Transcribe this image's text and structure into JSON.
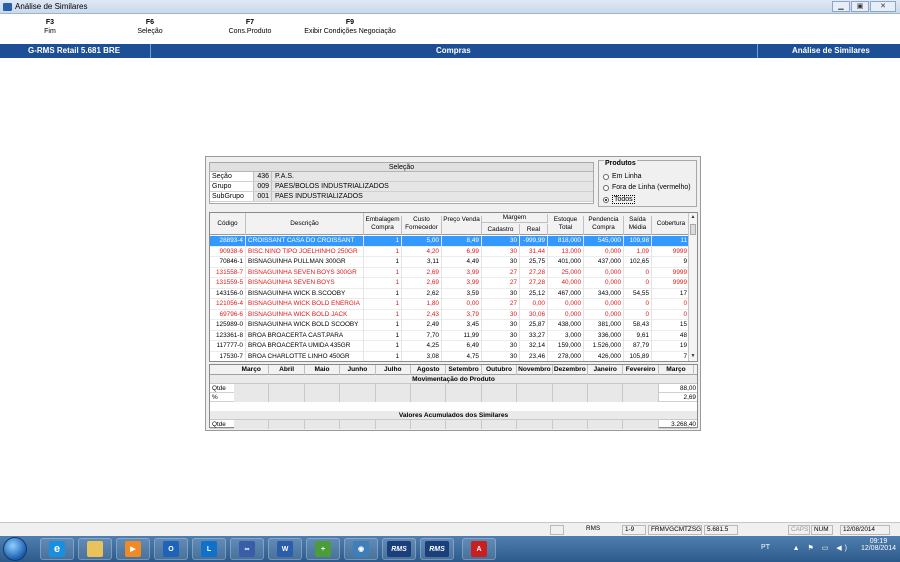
{
  "window": {
    "title": "Análise de Similares"
  },
  "fkeys": [
    {
      "key": "F3",
      "label": "Fim"
    },
    {
      "key": "F6",
      "label": "Seleção"
    },
    {
      "key": "F7",
      "label": "Cons.Produto"
    },
    {
      "key": "F9",
      "label": "Exibir Condições Negociação"
    }
  ],
  "banner": {
    "left": "G-RMS Retail 5.681 BRE",
    "center": "Compras",
    "right": "Análise de Similares"
  },
  "selecao": {
    "title": "Seleção",
    "rows": [
      {
        "label": "Seção",
        "code": "436",
        "desc": "P.A.S."
      },
      {
        "label": "Grupo",
        "code": "009",
        "desc": "PAES/BOLOS INDUSTRIALIZADOS"
      },
      {
        "label": "SubGrupo",
        "code": "001",
        "desc": "PAES INDUSTRIALIZADOS"
      }
    ]
  },
  "produtos": {
    "legend": "Produtos",
    "options": [
      "Em Linha",
      "Fora de Linha (vermelho)",
      "Todos"
    ],
    "selected": 2
  },
  "grid": {
    "headers": {
      "codigo": "Código",
      "descricao": "Descrição",
      "embalagem": "Embalagem Compra",
      "custo": "Custo Fornecedor",
      "preco": "Preço Venda",
      "margem": "Margem",
      "margem_cad": "Cadastro",
      "margem_real": "Real",
      "estoque": "Estoque Total",
      "pendencia": "Pendencia Compra",
      "saida": "Saída Média",
      "cobertura": "Cobertura"
    },
    "rows": [
      {
        "codigo": "28893-4",
        "desc": "CROISSANT CASA DO CROISSANT",
        "emb": "1",
        "custo": "5,00",
        "preco": "8,49",
        "cad": "30",
        "real": "-999,99",
        "estoque": "818,000",
        "pend": "545,000",
        "saida": "109,98",
        "cob": "11",
        "red": true,
        "selected": true
      },
      {
        "codigo": "90938-6",
        "desc": "BISC.NINO TIPO JOELHINHO 250GR",
        "emb": "1",
        "custo": "4,20",
        "preco": "6,99",
        "cad": "30",
        "real": "31,44",
        "estoque": "13,000",
        "pend": "0,000",
        "saida": "1,09",
        "cob": "9999",
        "red": true
      },
      {
        "codigo": "70846-1",
        "desc": "BISNAGUINHA PULLMAN 300GR",
        "emb": "1",
        "custo": "3,11",
        "preco": "4,49",
        "cad": "30",
        "real": "25,75",
        "estoque": "401,000",
        "pend": "437,000",
        "saida": "102,65",
        "cob": "9",
        "red": false
      },
      {
        "codigo": "131558-7",
        "desc": "BISNAGUINHA SEVEN BOYS 300GR",
        "emb": "1",
        "custo": "2,69",
        "preco": "3,99",
        "cad": "27",
        "real": "27,28",
        "estoque": "25,000",
        "pend": "0,000",
        "saida": "0",
        "cob": "9999",
        "red": true
      },
      {
        "codigo": "131559-5",
        "desc": "BISNAGUINHA SEVEN BOYS",
        "emb": "1",
        "custo": "2,69",
        "preco": "3,99",
        "cad": "27",
        "real": "27,28",
        "estoque": "40,000",
        "pend": "0,000",
        "saida": "0",
        "cob": "9999",
        "red": true
      },
      {
        "codigo": "143156-0",
        "desc": "BISNAGUINHA WICK B.SCOOBY",
        "emb": "1",
        "custo": "2,62",
        "preco": "3,59",
        "cad": "30",
        "real": "25,12",
        "estoque": "467,000",
        "pend": "343,000",
        "saida": "54,55",
        "cob": "17",
        "red": false
      },
      {
        "codigo": "121056-4",
        "desc": "BISNAGUINHA WICK BOLD ENERGIA",
        "emb": "1",
        "custo": "1,80",
        "preco": "0,00",
        "cad": "27",
        "real": "0,00",
        "estoque": "0,000",
        "pend": "0,000",
        "saida": "0",
        "cob": "0",
        "red": true
      },
      {
        "codigo": "69796-6",
        "desc": "BISNAGUINHA WICK BOLD JACK",
        "emb": "1",
        "custo": "2,43",
        "preco": "3,79",
        "cad": "30",
        "real": "30,06",
        "estoque": "0,000",
        "pend": "0,000",
        "saida": "0",
        "cob": "0",
        "red": true
      },
      {
        "codigo": "125989-0",
        "desc": "BISNAGUINHA WICK BOLD SCOOBY",
        "emb": "1",
        "custo": "2,49",
        "preco": "3,45",
        "cad": "30",
        "real": "25,87",
        "estoque": "438,000",
        "pend": "381,000",
        "saida": "58,43",
        "cob": "15",
        "red": false
      },
      {
        "codigo": "123361-8",
        "desc": "BROA BROACERTA CAST.PARA",
        "emb": "1",
        "custo": "7,70",
        "preco": "11,99",
        "cad": "30",
        "real": "33,27",
        "estoque": "3,000",
        "pend": "336,000",
        "saida": "9,61",
        "cob": "48",
        "red": false
      },
      {
        "codigo": "117777-0",
        "desc": "BROA BROACERTA UMIDA 435GR",
        "emb": "1",
        "custo": "4,25",
        "preco": "6,49",
        "cad": "30",
        "real": "32,14",
        "estoque": "159,000",
        "pend": "1.526,000",
        "saida": "87,79",
        "cob": "19",
        "red": false
      },
      {
        "codigo": "17530-7",
        "desc": "BROA CHARLOTTE LINHO 450GR",
        "emb": "1",
        "custo": "3,08",
        "preco": "4,75",
        "cad": "30",
        "real": "23,46",
        "estoque": "278,000",
        "pend": "426,000",
        "saida": "105,89",
        "cob": "7",
        "red": false
      }
    ]
  },
  "months": {
    "headers": [
      "Março",
      "Abril",
      "Maio",
      "Junho",
      "Julho",
      "Agosto",
      "Setembro",
      "Outubro",
      "Novembro",
      "Dezembro",
      "Janeiro",
      "Fevereiro",
      "Março"
    ],
    "section1": "Movimentação do Produto",
    "section2": "Valores Acumulados dos Similares",
    "rows": {
      "qtde_label": "Qtde",
      "qtde_total": "88,00",
      "pct_label": "%",
      "pct_total": "2,69",
      "acc_label": "Qtde",
      "acc_total": "3.268,40"
    }
  },
  "statusbar": {
    "rms": "RMS",
    "page": "1-9",
    "prog": "FRMVGCMTZSG",
    "version": "5.681.5",
    "caps": "CAPS",
    "num": "NUM",
    "date": "12/08/2014"
  },
  "taskbar": {
    "lang": "PT",
    "time": "09:19",
    "date": "12/08/2014",
    "apps": [
      "ie-icon",
      "explorer-icon",
      "media-player-icon",
      "outlook-icon",
      "lync-icon",
      "ceoc-icon",
      "word-icon",
      "tool-icon",
      "remote-icon",
      "rms-icon",
      "rms-icon-2",
      "acrobat-icon"
    ],
    "app_labels": {
      "rms1": "RMS",
      "rms2": "RMS"
    }
  }
}
